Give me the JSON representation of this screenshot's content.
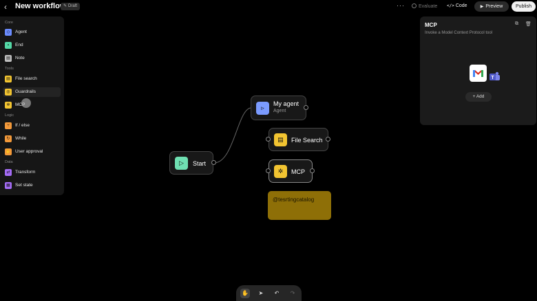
{
  "header": {
    "back_icon": "chevron-left-icon",
    "title": "New workflow",
    "draft_label": "Draft",
    "more_icon": "ellipsis-icon",
    "evaluate_label": "Evaluate",
    "code_label": "Code",
    "preview_label": "Preview",
    "publish_label": "Publish"
  },
  "sidebar": {
    "sections": [
      {
        "label": "Core",
        "items": [
          {
            "label": "Agent",
            "icon": "agent-icon",
            "color": "#6b8cff"
          },
          {
            "label": "End",
            "icon": "end-icon",
            "color": "#54d8a6"
          },
          {
            "label": "Note",
            "icon": "note-icon",
            "color": "#bdbdbd"
          }
        ]
      },
      {
        "label": "Tools",
        "items": [
          {
            "label": "File search",
            "icon": "file-search-icon",
            "color": "#f2c431"
          },
          {
            "label": "Guardrails",
            "icon": "guardrails-icon",
            "color": "#f2c431"
          },
          {
            "label": "MCP",
            "icon": "mcp-icon",
            "color": "#f2c431"
          }
        ]
      },
      {
        "label": "Logic",
        "items": [
          {
            "label": "If / else",
            "icon": "branch-icon",
            "color": "#f2993a"
          },
          {
            "label": "While",
            "icon": "loop-icon",
            "color": "#f2993a"
          },
          {
            "label": "User approval",
            "icon": "approval-icon",
            "color": "#f2993a"
          }
        ]
      },
      {
        "label": "Data",
        "items": [
          {
            "label": "Transform",
            "icon": "transform-icon",
            "color": "#a46cf5"
          },
          {
            "label": "Set state",
            "icon": "set-state-icon",
            "color": "#a46cf5"
          }
        ]
      }
    ]
  },
  "canvas": {
    "start": {
      "label": "Start",
      "icon": "play-icon",
      "color": "#6fe0b2"
    },
    "agent": {
      "label": "My agent",
      "sublabel": "Agent",
      "icon": "agent-icon",
      "color": "#7b9bff"
    },
    "file_search": {
      "label": "File Search",
      "icon": "file-search-icon",
      "color": "#f2c431"
    },
    "mcp": {
      "label": "MCP",
      "icon": "mcp-icon",
      "color": "#f2c431"
    },
    "note": {
      "text": "@tesrtingcatalog",
      "color": "#8e6f07"
    }
  },
  "panel": {
    "title": "MCP",
    "description": "Invoke a Model Context Protocol tool",
    "add_label": "Add",
    "integrations": [
      "gmail-icon",
      "teams-icon"
    ]
  },
  "toolbar": {
    "tools": [
      "hand-icon",
      "pointer-icon",
      "undo-icon",
      "redo-icon"
    ],
    "active_tool": "hand-icon"
  }
}
